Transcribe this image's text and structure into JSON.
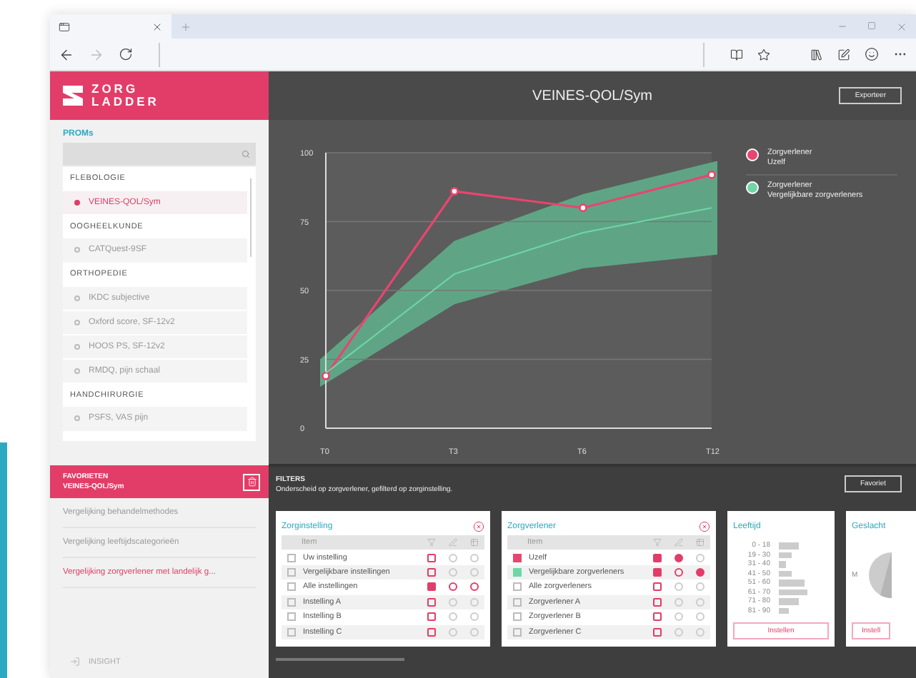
{
  "logo": {
    "line_1": "ZORG",
    "line_2": "LADDER"
  },
  "sidebar": {
    "section": "PROMs",
    "groups": [
      {
        "name": "FLEBOLOGIE",
        "items": [
          {
            "label": "VEINES-QOL/Sym",
            "selected": true
          }
        ]
      },
      {
        "name": "OOGHEELKUNDE",
        "items": [
          {
            "label": "CATQuest-9SF",
            "selected": false
          }
        ]
      },
      {
        "name": "ORTHOPEDIE",
        "items": [
          {
            "label": "IKDC subjective",
            "selected": false
          },
          {
            "label": "Oxford score, SF-12v2",
            "selected": false
          },
          {
            "label": "HOOS PS, SF-12v2",
            "selected": false
          },
          {
            "label": "RMDQ, pijn schaal",
            "selected": false
          }
        ]
      },
      {
        "name": "HANDCHIRURGIE",
        "items": [
          {
            "label": "PSFS, VAS pijn",
            "selected": false
          }
        ]
      }
    ],
    "favorites": {
      "title": "FAVORIETEN",
      "subtitle": "VEINES-QOL/Sym",
      "items": [
        {
          "label": "Vergelijking behandelmethodes",
          "selected": false
        },
        {
          "label": "Vergelijking leeftijdscategorieën",
          "selected": false
        },
        {
          "label": "Vergelijking zorgverlener met landelijk g...",
          "selected": true
        }
      ]
    },
    "footer": "INSIGHT"
  },
  "header": {
    "title": "VEINES-QOL/Sym",
    "export_button": "Exporteer"
  },
  "chart": {
    "chart_data": {
      "type": "line",
      "categories": [
        "T0",
        "T3",
        "T6",
        "T12"
      ],
      "ylim": [
        0,
        100
      ],
      "yticks": [
        0,
        25,
        50,
        75,
        100
      ],
      "grid": true,
      "series": [
        {
          "name": "Zorgverlener",
          "color": "#e8456f",
          "marker": "circle",
          "values": [
            19,
            86,
            80,
            92
          ]
        },
        {
          "name": "Zorgverlener",
          "color": "#6fd6a6",
          "values": [
            20,
            56,
            71,
            80
          ]
        }
      ]
    },
    "legend": [
      {
        "subtitle": "Uzelf"
      },
      {
        "subtitle": "Vergelijkbare zorgverleners"
      }
    ]
  },
  "filters": {
    "title": "FILTERS",
    "description": "Onderscheid op zorgverlener, gefilterd op zorginstelling.",
    "favorite_button": "Favoriet",
    "cards": [
      {
        "kind": "table",
        "title": "Zorginstelling",
        "column": "Item",
        "closable": true,
        "rows": [
          {
            "label": "Uw instelling",
            "checked": false,
            "marks": [
              {
                "selected": false,
                "enabled": true
              },
              {
                "selected": false,
                "enabled": false
              },
              {
                "selected": false,
                "enabled": false
              }
            ]
          },
          {
            "label": "Vergelijkbare instellingen",
            "checked": false,
            "marks": [
              {
                "selected": false,
                "enabled": true
              },
              {
                "selected": false,
                "enabled": false
              },
              {
                "selected": false,
                "enabled": false
              }
            ]
          },
          {
            "label": "Alle instellingen",
            "checked": false,
            "marks": [
              {
                "selected": true,
                "enabled": true
              },
              {
                "selected": false,
                "enabled": true
              },
              {
                "selected": false,
                "enabled": true
              }
            ]
          },
          {
            "label": "Instelling A",
            "checked": false,
            "marks": [
              {
                "selected": false,
                "enabled": true
              },
              {
                "selected": false,
                "enabled": false
              },
              {
                "selected": false,
                "enabled": false
              }
            ]
          },
          {
            "label": "Instelling B",
            "checked": false,
            "marks": [
              {
                "selected": false,
                "enabled": true
              },
              {
                "selected": false,
                "enabled": false
              },
              {
                "selected": false,
                "enabled": false
              }
            ]
          },
          {
            "label": "Instelling C",
            "checked": false,
            "marks": [
              {
                "selected": false,
                "enabled": true
              },
              {
                "selected": false,
                "enabled": false
              },
              {
                "selected": false,
                "enabled": false
              }
            ]
          }
        ]
      },
      {
        "kind": "table",
        "title": "Zorgverlener",
        "column": "Item",
        "closable": true,
        "rows": [
          {
            "label": "Uzelf",
            "checked": true,
            "color": "#e8456f",
            "marks": [
              {
                "selected": true,
                "enabled": true
              },
              {
                "selected": true,
                "enabled": true
              },
              {
                "selected": false,
                "enabled": false
              }
            ]
          },
          {
            "label": "Vergelijkbare zorgverleners",
            "checked": true,
            "color": "#6fd6a6",
            "marks": [
              {
                "selected": true,
                "enabled": true
              },
              {
                "selected": false,
                "enabled": true
              },
              {
                "selected": true,
                "enabled": true
              }
            ]
          },
          {
            "label": "Alle zorgverleners",
            "checked": false,
            "marks": [
              {
                "selected": false,
                "enabled": true
              },
              {
                "selected": false,
                "enabled": false
              },
              {
                "selected": false,
                "enabled": false
              }
            ]
          },
          {
            "label": "Zorgverlener A",
            "checked": false,
            "marks": [
              {
                "selected": false,
                "enabled": true
              },
              {
                "selected": false,
                "enabled": false
              },
              {
                "selected": false,
                "enabled": false
              }
            ]
          },
          {
            "label": "Zorgverlener B",
            "checked": false,
            "marks": [
              {
                "selected": false,
                "enabled": true
              },
              {
                "selected": false,
                "enabled": false
              },
              {
                "selected": false,
                "enabled": false
              }
            ]
          },
          {
            "label": "Zorgverlener C",
            "checked": false,
            "marks": [
              {
                "selected": false,
                "enabled": true
              },
              {
                "selected": false,
                "enabled": false
              },
              {
                "selected": false,
                "enabled": false
              }
            ]
          }
        ]
      },
      {
        "kind": "histogram",
        "title": "Leeftijd",
        "labels": [
          "0 - 18",
          "19 - 30",
          "31 - 40",
          "41 - 50",
          "51 - 60",
          "61 - 70",
          "71 - 80",
          "81 - 90"
        ],
        "button": "Instellen"
      },
      {
        "kind": "pie",
        "title": "Geslacht",
        "label": "M",
        "button": "Instell"
      }
    ]
  }
}
